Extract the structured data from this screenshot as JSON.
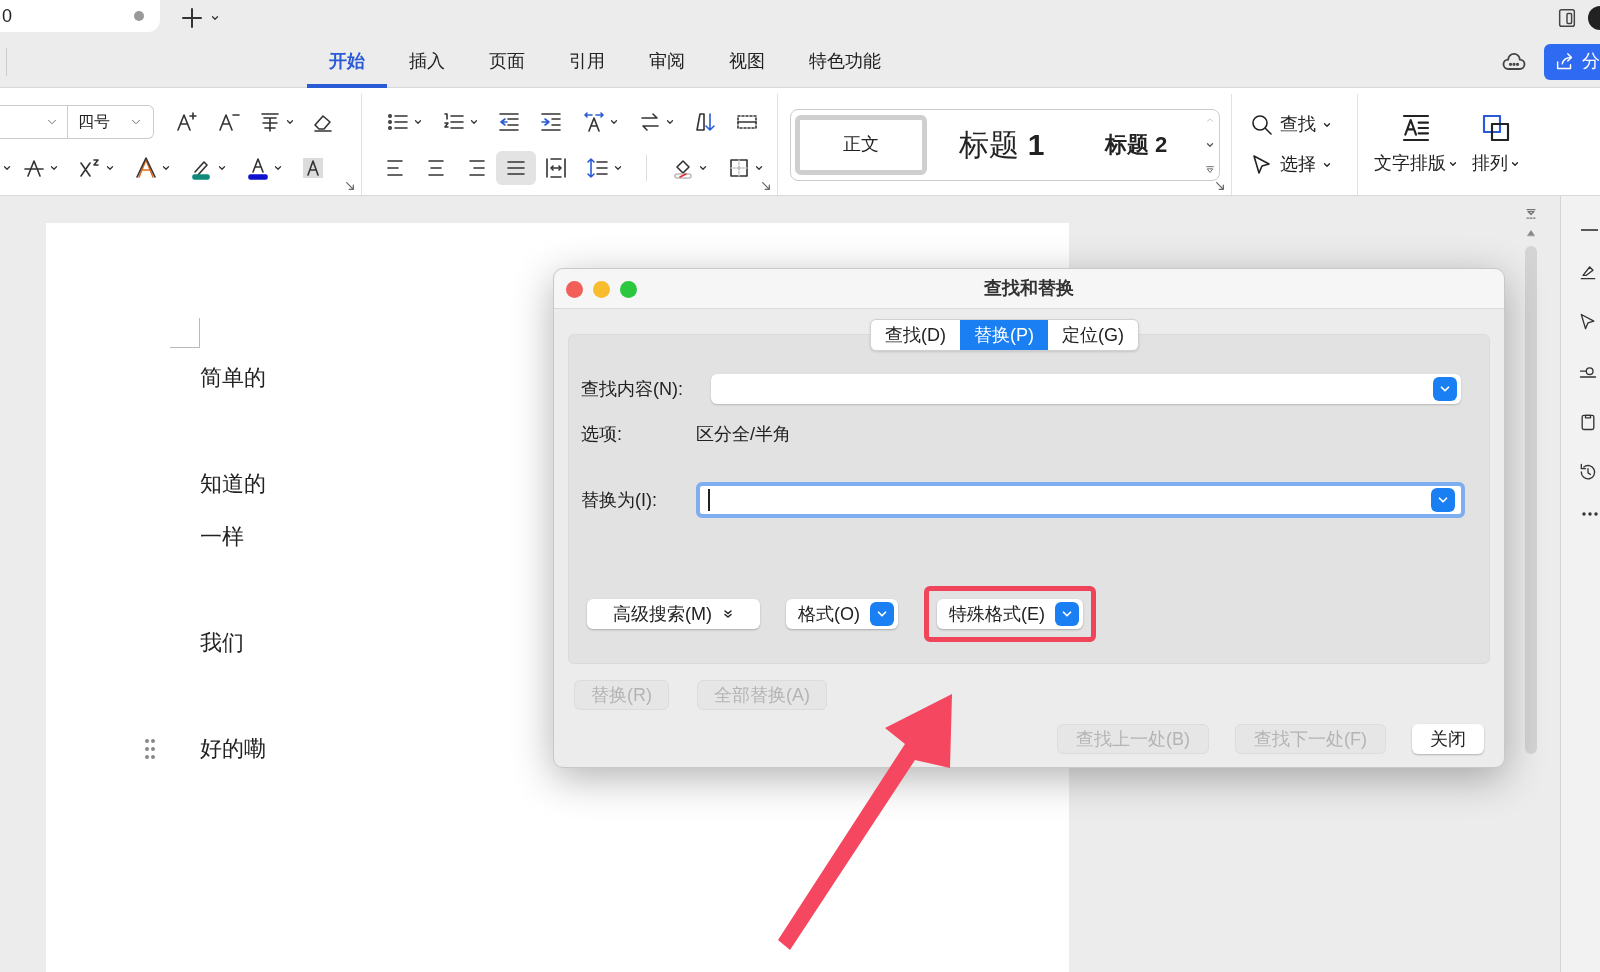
{
  "document_tab": {
    "title": "0"
  },
  "ribbon_tabs": [
    {
      "label": "开始",
      "selected": true
    },
    {
      "label": "插入",
      "selected": false
    },
    {
      "label": "页面",
      "selected": false
    },
    {
      "label": "引用",
      "selected": false
    },
    {
      "label": "审阅",
      "selected": false
    },
    {
      "label": "视图",
      "selected": false
    },
    {
      "label": "特色功能",
      "selected": false
    }
  ],
  "share_button": {
    "label": "分"
  },
  "toolbar": {
    "font_size": "四号",
    "alignment_buttons": [
      {
        "selected": false
      },
      {
        "selected": false
      },
      {
        "selected": false
      },
      {
        "selected": true
      },
      {
        "selected": false
      }
    ],
    "styles": [
      {
        "label": "正文",
        "kind": "body",
        "selected": true
      },
      {
        "label": "标题 **1**",
        "kind": "heading1",
        "selected": false
      },
      {
        "label": "标题 2",
        "kind": "heading2",
        "selected": false
      }
    ],
    "find": "查找",
    "select": "选择",
    "text_layout": "文字排版",
    "arrange": "排列"
  },
  "document": {
    "paragraphs": [
      "简单的",
      "知道的",
      "一样",
      "我们",
      "好的嘞"
    ]
  },
  "dialog": {
    "title": "查找和替换",
    "tabs": [
      {
        "label": "查找(D)",
        "selected": false
      },
      {
        "label": "替换(P)",
        "selected": true
      },
      {
        "label": "定位(G)",
        "selected": false
      }
    ],
    "find_label": "查找内容(N):",
    "options_label": "选项:",
    "options_value": "区分全/半角",
    "replace_label": "替换为(I):",
    "replace_focused": true,
    "option_buttons": [
      {
        "label": "高级搜索(M)",
        "kind": "menu",
        "annotated": false
      },
      {
        "label": "格式(O)",
        "kind": "dropdown",
        "annotated": false
      },
      {
        "label": "特殊格式(E)",
        "kind": "dropdown",
        "annotated": true
      }
    ],
    "action_buttons": [
      {
        "label": "替换(R)",
        "disabled": true
      },
      {
        "label": "全部替换(A)",
        "disabled": true
      }
    ],
    "nav_buttons": [
      {
        "label": "查找上一处(B)",
        "disabled": true
      },
      {
        "label": "查找下一处(F)",
        "disabled": true
      },
      {
        "label": "关闭",
        "disabled": false
      }
    ]
  }
}
